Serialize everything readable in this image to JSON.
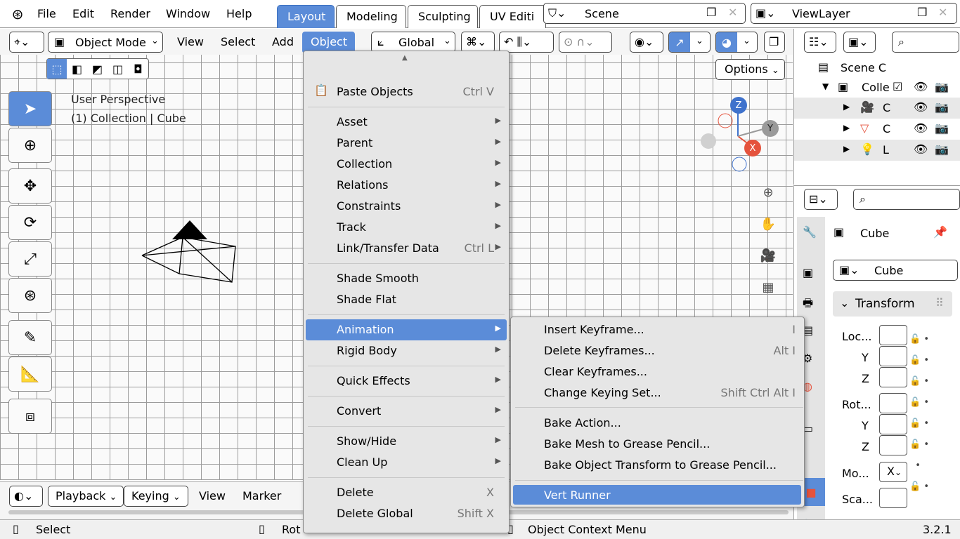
{
  "menubar": {
    "file": "File",
    "edit": "Edit",
    "render": "Render",
    "window": "Window",
    "help": "Help"
  },
  "workspaces": [
    "Layout",
    "Modeling",
    "Sculpting",
    "UV Editi"
  ],
  "scene": {
    "name": "Scene",
    "view_layer": "ViewLayer"
  },
  "header": {
    "mode": "Object Mode",
    "view": "View",
    "select": "Select",
    "add": "Add",
    "object": "Object",
    "transform_orientation": "Global",
    "options": "Options"
  },
  "viewport": {
    "perspective": "User Perspective",
    "collection_info": "(1) Collection | Cube",
    "gizmo": {
      "z": "Z",
      "y": "Y",
      "x": "X"
    }
  },
  "object_menu": {
    "items": [
      {
        "label": "Paste Objects",
        "shortcut": "Ctrl V"
      },
      {
        "label": "Asset"
      },
      {
        "label": "Parent"
      },
      {
        "label": "Collection"
      },
      {
        "label": "Relations"
      },
      {
        "label": "Constraints"
      },
      {
        "label": "Track"
      },
      {
        "label": "Link/Transfer Data",
        "shortcut": "Ctrl L"
      },
      {
        "label": "Shade Smooth"
      },
      {
        "label": "Shade Flat"
      },
      {
        "label": "Animation"
      },
      {
        "label": "Rigid Body"
      },
      {
        "label": "Quick Effects"
      },
      {
        "label": "Convert"
      },
      {
        "label": "Show/Hide"
      },
      {
        "label": "Clean Up"
      },
      {
        "label": "Delete",
        "shortcut": "X"
      },
      {
        "label": "Delete Global",
        "shortcut": "Shift X"
      }
    ]
  },
  "animation_submenu": {
    "items": [
      {
        "label": "Insert Keyframe...",
        "shortcut": "I"
      },
      {
        "label": "Delete Keyframes...",
        "shortcut": "Alt I"
      },
      {
        "label": "Clear Keyframes...",
        "shortcut": ""
      },
      {
        "label": "Change Keying Set...",
        "shortcut": "Shift Ctrl Alt I"
      },
      {
        "label": "Bake Action...",
        "shortcut": ""
      },
      {
        "label": "Bake Mesh to Grease Pencil...",
        "shortcut": ""
      },
      {
        "label": "Bake Object Transform to Grease Pencil...",
        "shortcut": ""
      },
      {
        "label": "Vert Runner",
        "shortcut": ""
      }
    ]
  },
  "outliner": {
    "scene_label": "Scene C",
    "collection_label": "Colle",
    "rows": [
      "C",
      "C",
      "L"
    ]
  },
  "properties": {
    "object_name": "Cube",
    "data_name": "Cube",
    "panel": "Transform",
    "location_label": "Loc...",
    "rotation_label": "Rot...",
    "scale_label": "Sca...",
    "mode_label": "Mo...",
    "mode_value": "X",
    "y": "Y",
    "z": "Z"
  },
  "timeline": {
    "playback": "Playback",
    "keying": "Keying",
    "view": "View",
    "marker": "Marker"
  },
  "statusbar": {
    "select": "Select",
    "rotate": "Rot",
    "context": "Object Context Menu",
    "version": "3.2.1"
  },
  "colors": {
    "accent": "#5b8cd8",
    "x_axis": "#e5533d",
    "y_axis": "#9a9a9a",
    "z_axis": "#3f72cc"
  }
}
